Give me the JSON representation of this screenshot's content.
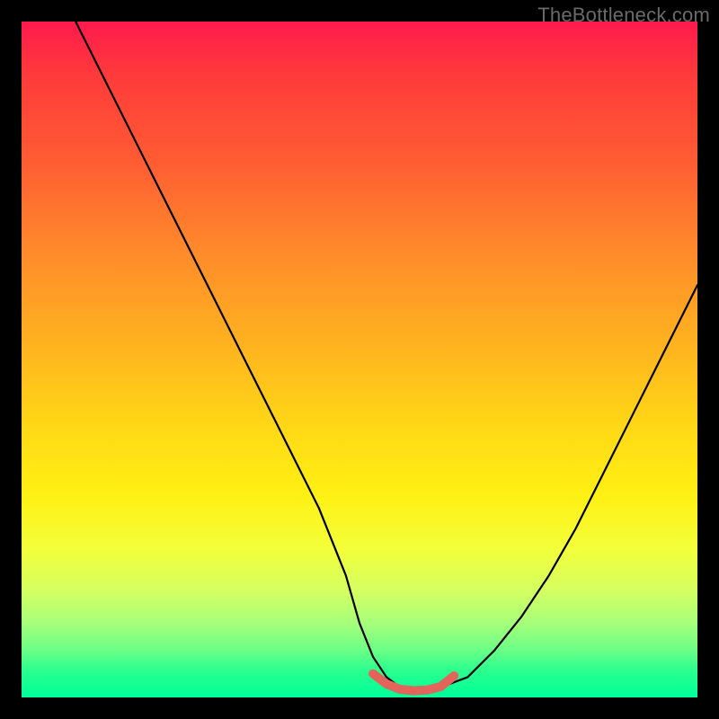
{
  "watermark": {
    "text": "TheBottleneck.com"
  },
  "colors": {
    "frame": "#000000",
    "curve": "#000000",
    "highlight": "#e2645b",
    "gradient_stops": [
      "#ff1a4d",
      "#ff3b3b",
      "#ff5a33",
      "#ff8a2b",
      "#ffb31f",
      "#ffd816",
      "#fff013",
      "#f3ff3a",
      "#d6ff60",
      "#a6ff7a",
      "#6bff85",
      "#2aff8e",
      "#00ff99"
    ]
  },
  "chart_data": {
    "type": "line",
    "title": "",
    "xlabel": "",
    "ylabel": "",
    "xlim": [
      0,
      100
    ],
    "ylim": [
      0,
      100
    ],
    "grid": false,
    "legend": false,
    "series": [
      {
        "name": "bottleneck-curve",
        "x": [
          8,
          12,
          16,
          20,
          24,
          28,
          32,
          36,
          40,
          44,
          48,
          50,
          52,
          54,
          56,
          58,
          60,
          62,
          66,
          70,
          74,
          78,
          82,
          86,
          90,
          94,
          98,
          100
        ],
        "y": [
          100,
          92,
          84,
          76,
          68,
          60,
          52,
          44,
          36,
          28,
          18,
          11,
          6,
          3,
          1.5,
          1,
          1,
          1.5,
          3,
          7,
          12,
          18,
          25,
          33,
          41,
          49,
          57,
          61
        ]
      }
    ],
    "annotations": [
      {
        "name": "valley-highlight",
        "kind": "segment",
        "x": [
          52,
          54,
          56,
          58,
          60,
          62,
          64
        ],
        "y": [
          3.5,
          2,
          1.2,
          1,
          1.1,
          1.6,
          3.2
        ],
        "stroke": "#e2645b",
        "stroke_width_px": 10
      }
    ]
  }
}
